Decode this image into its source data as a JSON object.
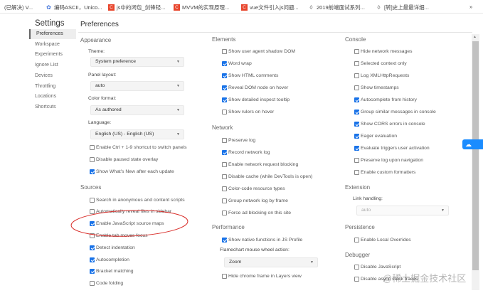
{
  "bookmarks": [
    {
      "label": "(已解决) V...",
      "icon": "none"
    },
    {
      "label": "编码ASCII，Unico...",
      "icon": "gear-flower-icon"
    },
    {
      "label": "js中的闭包_剑锋轻...",
      "icon": "csdn-icon"
    },
    {
      "label": "MVVM的实现原理...",
      "icon": "csdn-icon"
    },
    {
      "label": "vue文件引入js问题...",
      "icon": "csdn-icon"
    },
    {
      "label": "2019前端面试系列...",
      "icon": "juejin-icon"
    },
    {
      "label": "[转]史上最最详细...",
      "icon": "juejin-icon"
    }
  ],
  "bookmarks_overflow": "»",
  "sidebar": {
    "title": "Settings",
    "items": [
      "Preferences",
      "Workspace",
      "Experiments",
      "Ignore List",
      "Devices",
      "Throttling",
      "Locations",
      "Shortcuts"
    ],
    "selected": "Preferences"
  },
  "page_title": "Preferences",
  "appearance": {
    "title": "Appearance",
    "theme": {
      "label": "Theme:",
      "value": "System preference"
    },
    "panel_layout": {
      "label": "Panel layout:",
      "value": "auto"
    },
    "color_format": {
      "label": "Color format:",
      "value": "As authored"
    },
    "language": {
      "label": "Language:",
      "value": "English (US) - English (US)"
    },
    "checkboxes": [
      {
        "label": "Enable Ctrl + 1-9 shortcut to switch panels",
        "checked": false
      },
      {
        "label": "Disable paused state overlay",
        "checked": false
      },
      {
        "label": "Show What's New after each update",
        "checked": true
      }
    ]
  },
  "sources": {
    "title": "Sources",
    "checkboxes": [
      {
        "label": "Search in anonymous and content scripts",
        "checked": false
      },
      {
        "label": "Automatically reveal files in sidebar",
        "checked": false
      },
      {
        "label": "Enable JavaScript source maps",
        "checked": true
      },
      {
        "label": "Enable tab moves focus",
        "checked": false
      },
      {
        "label": "Detect indentation",
        "checked": true
      },
      {
        "label": "Autocompletion",
        "checked": true
      },
      {
        "label": "Bracket matching",
        "checked": true
      },
      {
        "label": "Code folding",
        "checked": false
      }
    ]
  },
  "elements": {
    "title": "Elements",
    "checkboxes": [
      {
        "label": "Show user agent shadow DOM",
        "checked": false
      },
      {
        "label": "Word wrap",
        "checked": true
      },
      {
        "label": "Show HTML comments",
        "checked": true
      },
      {
        "label": "Reveal DOM node on hover",
        "checked": true
      },
      {
        "label": "Show detailed inspect tooltip",
        "checked": true
      },
      {
        "label": "Show rulers on hover",
        "checked": false
      }
    ]
  },
  "network": {
    "title": "Network",
    "checkboxes": [
      {
        "label": "Preserve log",
        "checked": false
      },
      {
        "label": "Record network log",
        "checked": true
      },
      {
        "label": "Enable network request blocking",
        "checked": false
      },
      {
        "label": "Disable cache (while DevTools is open)",
        "checked": false
      },
      {
        "label": "Color-code resource types",
        "checked": false
      },
      {
        "label": "Group network log by frame",
        "checked": false
      },
      {
        "label": "Force ad blocking on this site",
        "checked": false
      }
    ]
  },
  "performance": {
    "title": "Performance",
    "checkbox1": {
      "label": "Show native functions in JS Profile",
      "checked": true
    },
    "wheel": {
      "label": "Flamechart mouse wheel action:",
      "value": "Zoom"
    },
    "checkbox2": {
      "label": "Hide chrome frame in Layers view",
      "checked": false
    }
  },
  "console": {
    "title": "Console",
    "checkboxes": [
      {
        "label": "Hide network messages",
        "checked": false
      },
      {
        "label": "Selected context only",
        "checked": false
      },
      {
        "label": "Log XMLHttpRequests",
        "checked": false
      },
      {
        "label": "Show timestamps",
        "checked": false
      },
      {
        "label": "Autocomplete from history",
        "checked": true
      },
      {
        "label": "Group similar messages in console",
        "checked": true
      },
      {
        "label": "Show CORS errors in console",
        "checked": true
      },
      {
        "label": "Eager evaluation",
        "checked": true
      },
      {
        "label": "Evaluate triggers user activation",
        "checked": true
      },
      {
        "label": "Preserve log upon navigation",
        "checked": false
      },
      {
        "label": "Enable custom formatters",
        "checked": false
      }
    ]
  },
  "extension": {
    "title": "Extension",
    "link_handling": {
      "label": "Link handling:",
      "value": "auto"
    }
  },
  "persistence": {
    "title": "Persistence",
    "checkboxes": [
      {
        "label": "Enable Local Overrides",
        "checked": false
      }
    ]
  },
  "debugger": {
    "title": "Debugger",
    "checkboxes": [
      {
        "label": "Disable JavaScript",
        "checked": false
      },
      {
        "label": "Disable async stack traces",
        "checked": false
      }
    ]
  },
  "watermark": "@稀土掘金技术社区",
  "annotation_color": "#d9302c"
}
